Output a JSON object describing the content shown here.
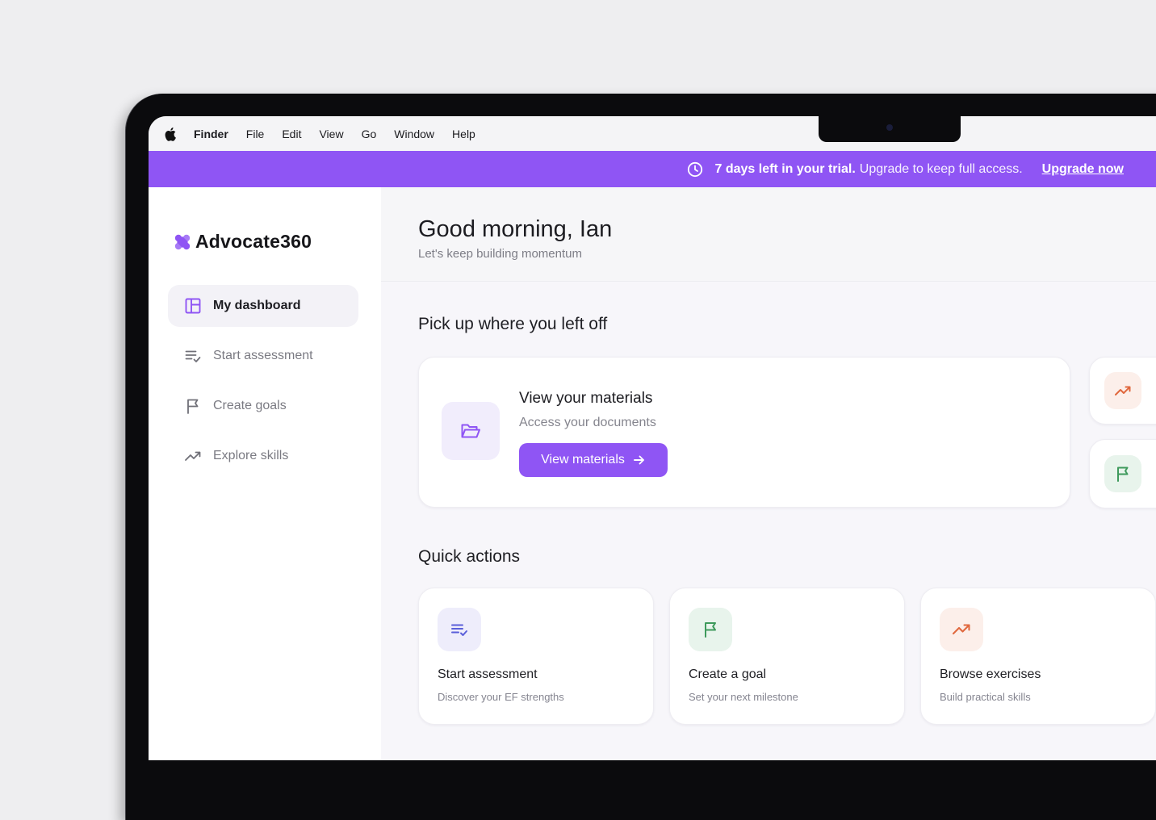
{
  "menubar": {
    "items": [
      "Finder",
      "File",
      "Edit",
      "View",
      "Go",
      "Window",
      "Help"
    ]
  },
  "banner": {
    "highlight": "7 days left in your trial.",
    "message": "Upgrade to keep full access.",
    "link": "Upgrade now"
  },
  "sidebar": {
    "logo": "Advocate360",
    "items": [
      {
        "label": "My dashboard"
      },
      {
        "label": "Start assessment"
      },
      {
        "label": "Create goals"
      },
      {
        "label": "Explore skills"
      }
    ]
  },
  "header": {
    "greeting": "Good morning, Ian",
    "subtitle": "Let's keep building momentum"
  },
  "resume": {
    "title": "Pick up where you left off",
    "card": {
      "title": "View your materials",
      "subtitle": "Access your documents",
      "button": "View materials"
    }
  },
  "quick_actions": {
    "title": "Quick actions",
    "items": [
      {
        "title": "Start assessment",
        "subtitle": "Discover your EF strengths"
      },
      {
        "title": "Create a goal",
        "subtitle": "Set your next milestone"
      },
      {
        "title": "Browse exercises",
        "subtitle": "Build practical skills"
      }
    ]
  },
  "colors": {
    "accent": "#8f55f4",
    "lavender_tile": "#f1edfc",
    "green_tile": "#e8f4ec",
    "peach_tile": "#fcefea"
  }
}
